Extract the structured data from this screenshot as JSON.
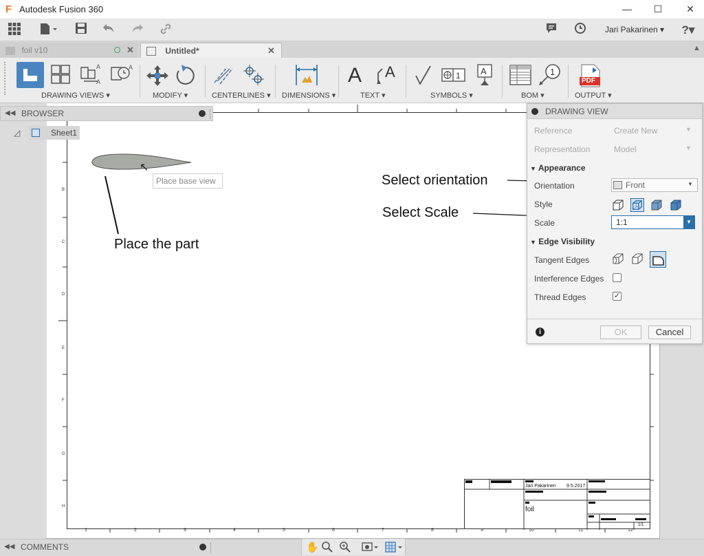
{
  "window": {
    "title": "Autodesk Fusion 360",
    "logo": "F",
    "minimize": "—",
    "maximize": "☐",
    "close": "✕"
  },
  "header": {
    "user": "Jari Pakarinen ▾",
    "help": "?▾"
  },
  "tabs": [
    {
      "label": "foil v10",
      "active": false
    },
    {
      "label": "Untitled*",
      "active": true
    }
  ],
  "ribbon": {
    "groups": [
      {
        "label": "DRAWING VIEWS ▾"
      },
      {
        "label": "MODIFY ▾"
      },
      {
        "label": "CENTERLINES ▾"
      },
      {
        "label": "DIMENSIONS ▾"
      },
      {
        "label": "TEXT ▾"
      },
      {
        "label": "SYMBOLS ▾"
      },
      {
        "label": "BOM ▾"
      },
      {
        "label": "OUTPUT ▾"
      }
    ],
    "pdf_label": "PDF"
  },
  "browser": {
    "title": "BROWSER",
    "sheet": "Sheet1"
  },
  "canvas": {
    "tooltip": "Place base view",
    "cursor": "↖"
  },
  "annotations": {
    "place_part": "Place the part",
    "select_orientation": "Select orientation",
    "select_scale": "Select Scale"
  },
  "panel": {
    "title": "DRAWING VIEW",
    "reference_label": "Reference",
    "reference_value": "Create New",
    "representation_label": "Representation",
    "representation_value": "Model",
    "appearance": "Appearance",
    "orientation_label": "Orientation",
    "orientation_value": "Front",
    "style_label": "Style",
    "scale_label": "Scale",
    "scale_value": "1:1",
    "edge_visibility": "Edge Visibility",
    "tangent_label": "Tangent Edges",
    "interference_label": "Interference Edges",
    "thread_label": "Thread Edges",
    "interference_checked": false,
    "thread_checked": true,
    "ok": "OK",
    "cancel": "Cancel"
  },
  "title_block": {
    "author": "Jari Pakarinen",
    "date": "9.5.2017",
    "name": "foil",
    "sheet": "1/1"
  },
  "sheet_ticks": {
    "top": [
      "1",
      "2",
      "3",
      "4",
      "5",
      "6",
      "7",
      "8",
      "9",
      "10",
      "11",
      "12"
    ],
    "bottom": [
      "1",
      "2",
      "3",
      "4",
      "5",
      "6",
      "7",
      "8",
      "9",
      "10",
      "11",
      "12"
    ],
    "left": [
      "A",
      "B",
      "C",
      "D",
      "E",
      "F",
      "G",
      "H"
    ]
  },
  "bottom": {
    "comments": "COMMENTS"
  },
  "colors": {
    "accent": "#2a6fa8",
    "highlight_ring": "#e06060",
    "airfoil_fill": "#a8aaa4"
  }
}
